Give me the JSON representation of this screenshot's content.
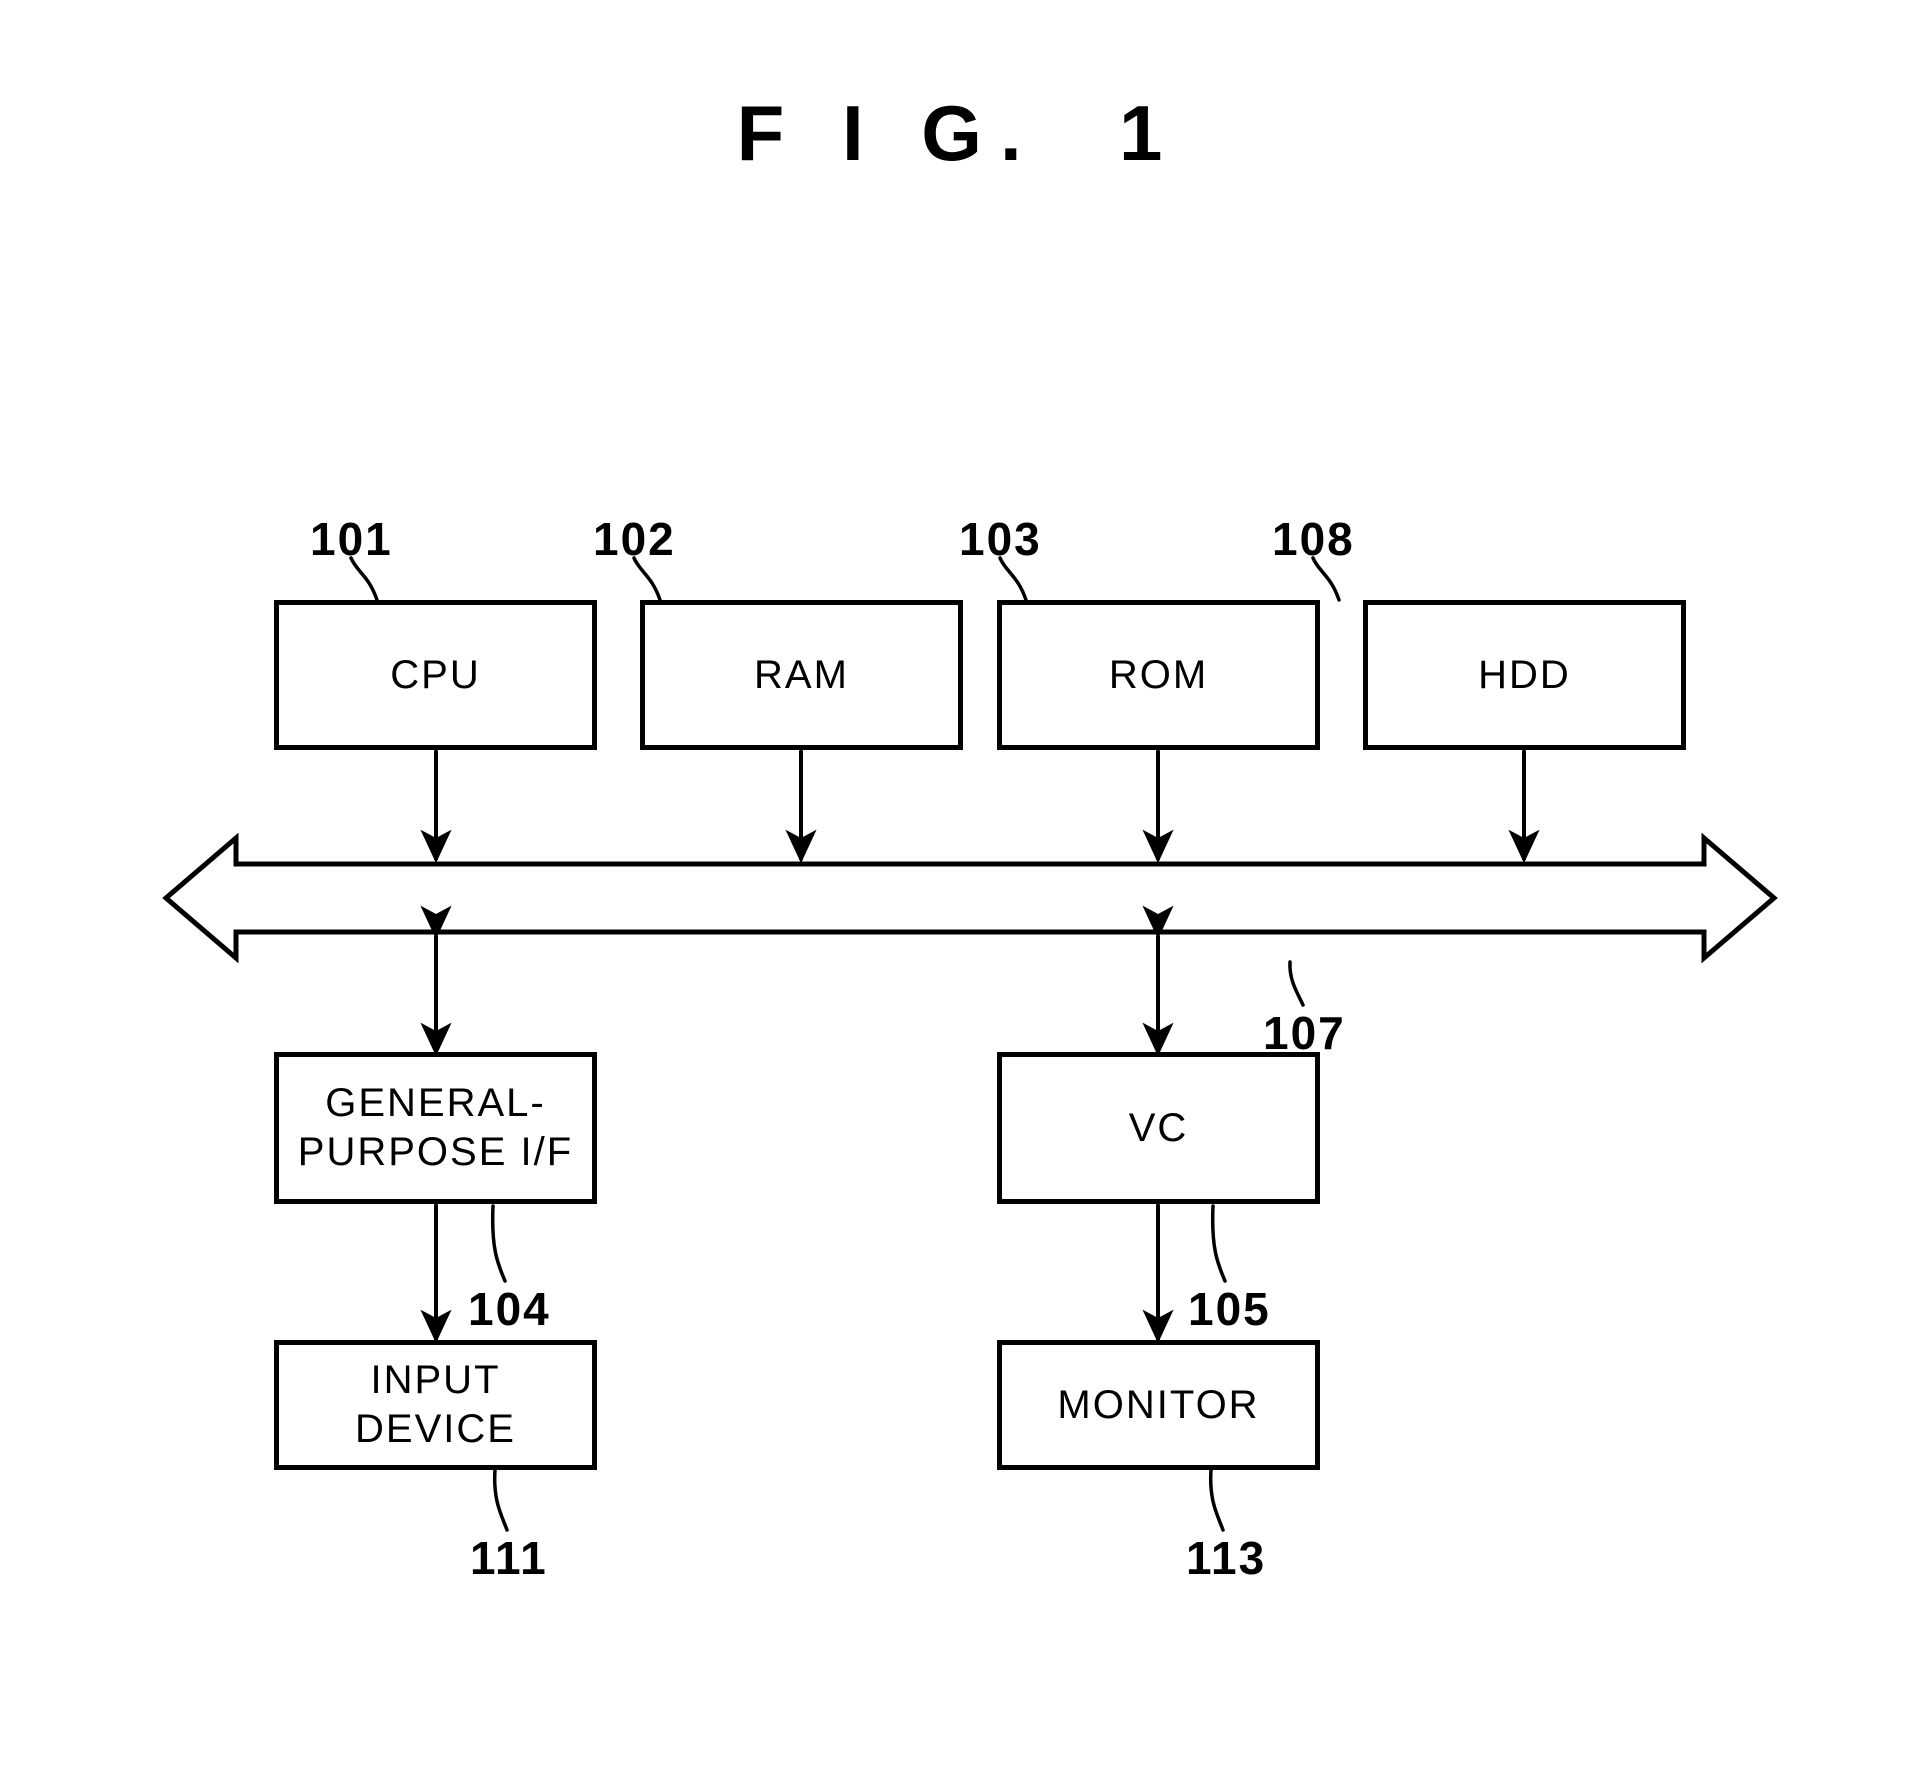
{
  "figure": {
    "title": "F I G.  1",
    "type": "patent-block-diagram",
    "subject": "information processing apparatus hardware configuration"
  },
  "boxes": [
    {
      "id": "cpu",
      "label": "CPU",
      "ref": "101"
    },
    {
      "id": "ram",
      "label": "RAM",
      "ref": "102"
    },
    {
      "id": "rom",
      "label": "ROM",
      "ref": "103"
    },
    {
      "id": "hdd",
      "label": "HDD",
      "ref": "108"
    },
    {
      "id": "gpif",
      "label": "GENERAL-\nPURPOSE I/F",
      "ref": "104"
    },
    {
      "id": "vc",
      "label": "VC",
      "ref": "105"
    },
    {
      "id": "input",
      "label": "INPUT\nDEVICE",
      "ref": "111"
    },
    {
      "id": "monitor",
      "label": "MONITOR",
      "ref": "113"
    }
  ],
  "bus": {
    "id": "system-bus",
    "ref": "107",
    "style": "hollow-double-headed-arrow"
  },
  "connectors": [
    {
      "from": "cpu",
      "to": "bus",
      "style": "double-headed-arrow"
    },
    {
      "from": "ram",
      "to": "bus",
      "style": "double-headed-arrow"
    },
    {
      "from": "rom",
      "to": "bus",
      "style": "double-headed-arrow"
    },
    {
      "from": "hdd",
      "to": "bus",
      "style": "double-headed-arrow"
    },
    {
      "from": "bus",
      "to": "gpif",
      "style": "double-headed-arrow"
    },
    {
      "from": "bus",
      "to": "vc",
      "style": "double-headed-arrow"
    },
    {
      "from": "gpif",
      "to": "input",
      "style": "double-headed-arrow"
    },
    {
      "from": "vc",
      "to": "monitor",
      "style": "double-headed-arrow"
    }
  ],
  "colors": {
    "ink": "#000000",
    "paper": "#ffffff"
  }
}
